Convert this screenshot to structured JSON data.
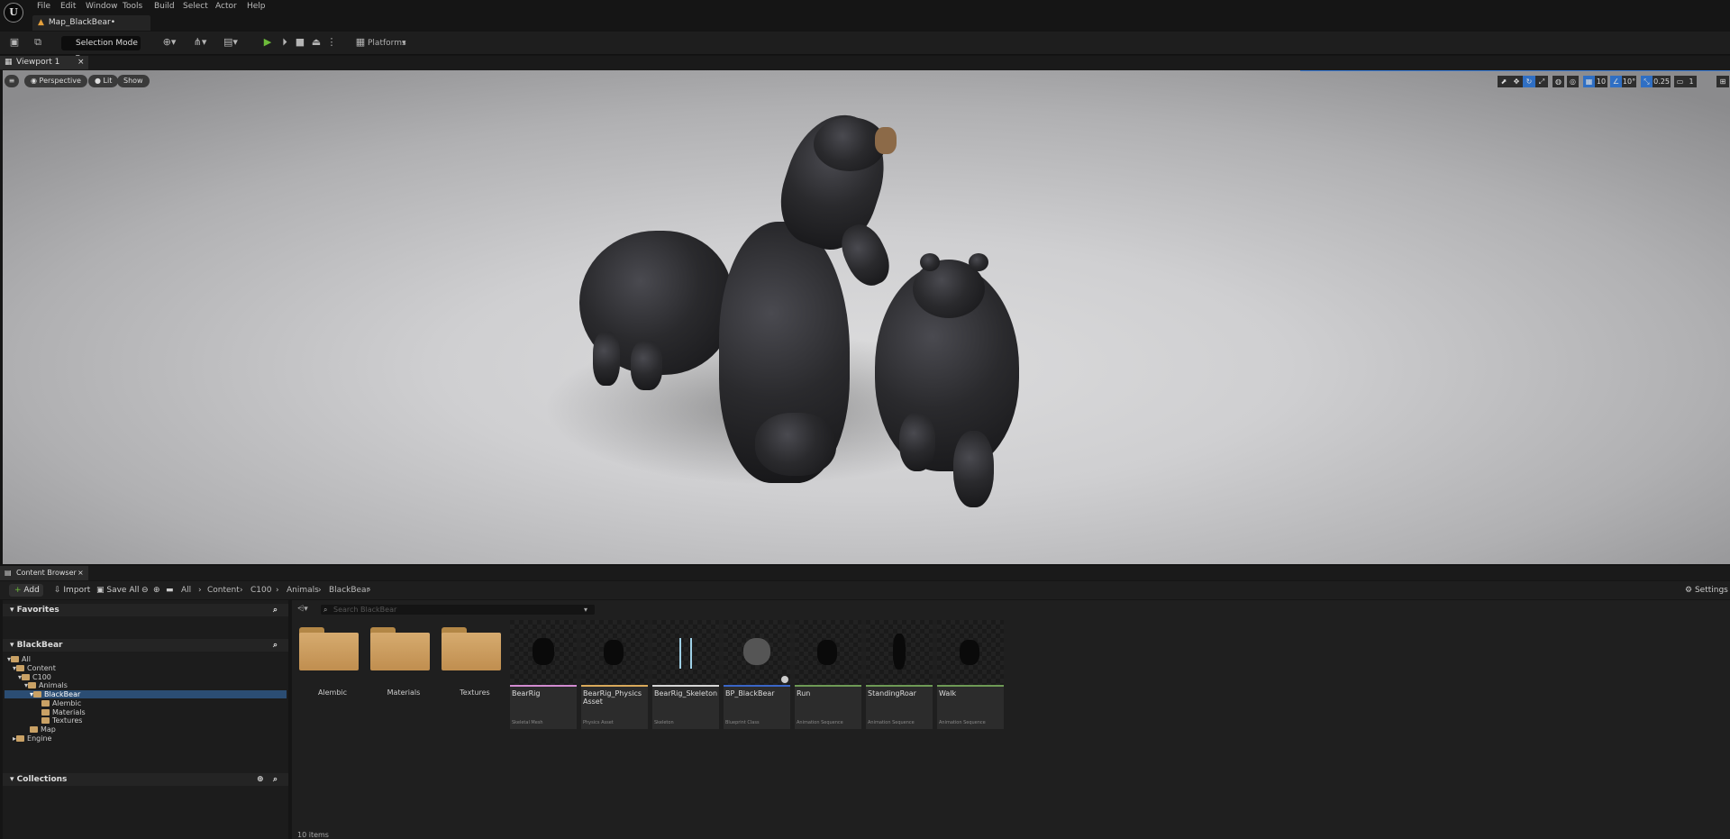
{
  "app": {
    "logo": "U"
  },
  "menu": [
    "File",
    "Edit",
    "Window",
    "Tools",
    "Build",
    "Select",
    "Actor",
    "Help"
  ],
  "map_tab": {
    "label": "Map_BlackBear•"
  },
  "toolbar": {
    "selection_mode": "Selection Mode",
    "platforms": "Platforms",
    "icons": [
      "save-icon",
      "content-icon",
      "add-actor-icon",
      "snap-icon",
      "cinematics-icon",
      "play-icon",
      "skip-icon",
      "stop-icon",
      "eject-icon",
      "more-icon",
      "platforms-icon"
    ]
  },
  "viewport": {
    "tab": "Viewport 1",
    "perspective": "Perspective",
    "lit": "Lit",
    "show": "Show",
    "grid_snap": "10",
    "rot_snap": "10°",
    "scale_snap": "0.25",
    "cam_speed": "1"
  },
  "content_browser": {
    "tab": "Content Browser",
    "add": "Add",
    "import": "Import",
    "save_all": "Save All",
    "settings": "Settings",
    "breadcrumb": [
      "All",
      "Content",
      "C100",
      "Animals",
      "BlackBear"
    ],
    "search_placeholder": "Search BlackBear",
    "favorites": "Favorites",
    "tree_header": "BlackBear",
    "collections": "Collections",
    "tree": [
      "All",
      "Content",
      "C100",
      "Animals",
      "BlackBear",
      "Alembic",
      "Materials",
      "Textures",
      "Map",
      "Engine"
    ],
    "folders": [
      "Alembic",
      "Materials",
      "Textures"
    ],
    "assets": [
      {
        "name": "BearRig",
        "type": "Skeletal Mesh",
        "color": "#d28bd0"
      },
      {
        "name": "BearRig_Physics Asset",
        "type": "Physics Asset",
        "color": "#d9a95a"
      },
      {
        "name": "BearRig_Skeleton",
        "type": "Skeleton",
        "color": "#d6d6d6"
      },
      {
        "name": "BP_BlackBear",
        "type": "Blueprint Class",
        "color": "#3a66c8"
      },
      {
        "name": "Run",
        "type": "Animation Sequence",
        "color": "#6e9a55"
      },
      {
        "name": "StandingRoar",
        "type": "Animation Sequence",
        "color": "#6e9a55"
      },
      {
        "name": "Walk",
        "type": "Animation Sequence",
        "color": "#6e9a55"
      }
    ],
    "item_count": "10 items"
  }
}
